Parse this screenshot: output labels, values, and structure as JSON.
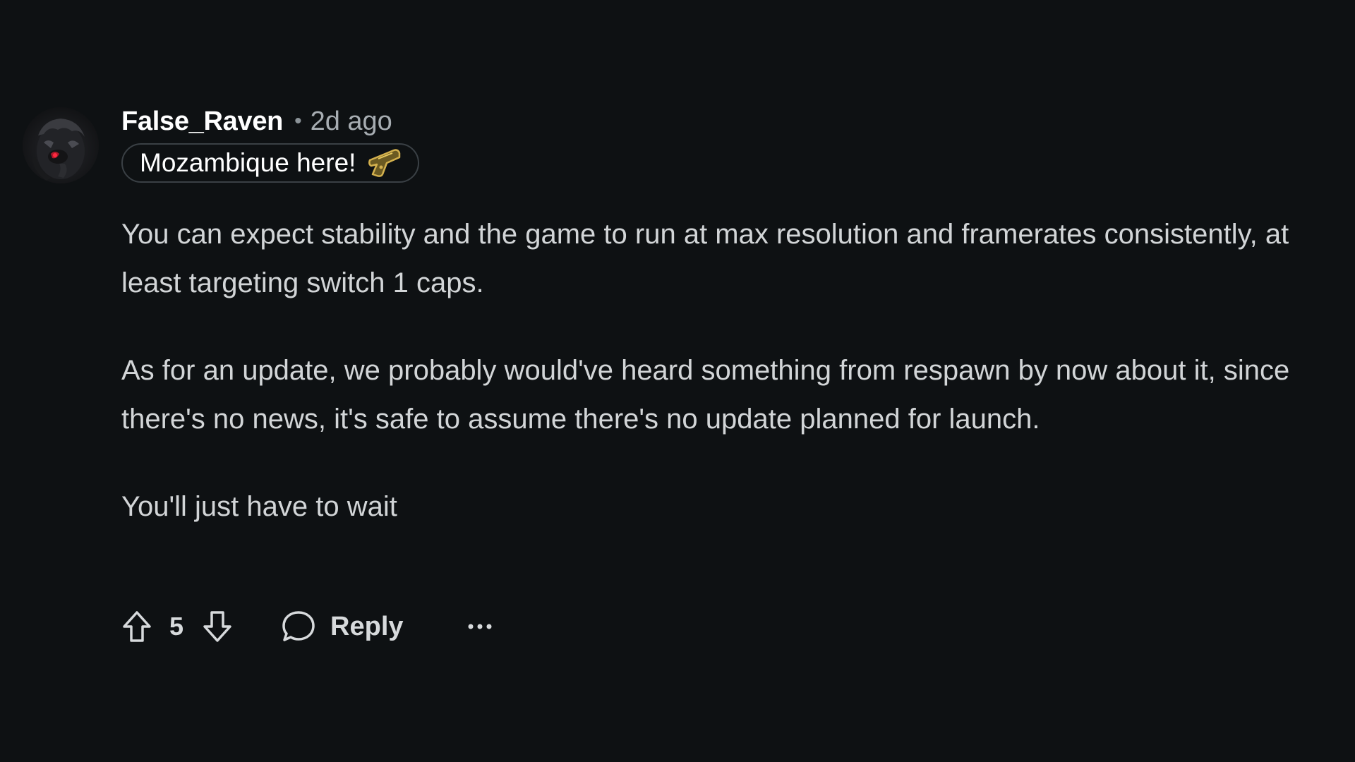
{
  "comment": {
    "author": "False_Raven",
    "separator": "•",
    "time": "2d ago",
    "flair": {
      "text": "Mozambique here!",
      "icon": "pistol-icon",
      "icon_color": "#c9a84a"
    },
    "paragraphs": [
      "You can expect stability and the game to run at max resolution and framerates consistently, at least targeting switch 1 caps.",
      "As for an update, we probably would've heard something from respawn by now about it, since there's no news, it's safe to assume there's no update planned for launch.",
      "You'll just have to wait"
    ],
    "actions": {
      "upvote_icon": "upvote-arrow-icon",
      "score": "5",
      "downvote_icon": "downvote-arrow-icon",
      "reply_icon": "speech-bubble-icon",
      "reply_label": "Reply",
      "more_icon": "ellipsis-icon"
    }
  },
  "colors": {
    "background": "#0e1113",
    "author": "#ffffff",
    "meta": "#a7adb2",
    "body_text": "#d2d5d7"
  }
}
